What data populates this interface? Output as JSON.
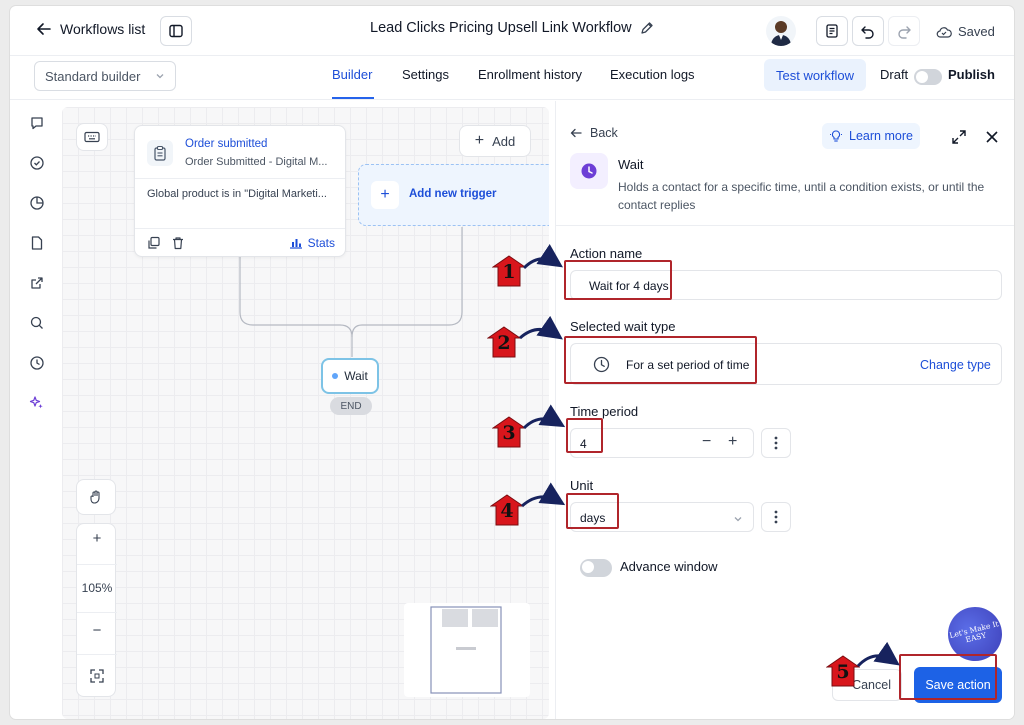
{
  "header": {
    "back_label": "Workflows list",
    "workflow_title": "Lead Clicks Pricing Upsell Link Workflow",
    "saved_label": "Saved"
  },
  "tabs_bar": {
    "builder_select": "Standard builder",
    "tabs": [
      {
        "label": "Builder",
        "active": true
      },
      {
        "label": "Settings",
        "active": false
      },
      {
        "label": "Enrollment history",
        "active": false
      },
      {
        "label": "Execution logs",
        "active": false
      }
    ],
    "test_workflow": "Test workflow",
    "draft_label": "Draft",
    "publish_label": "Publish"
  },
  "canvas": {
    "add_label": "Add",
    "trigger": {
      "title": "Order submitted",
      "subtitle": "Order Submitted - Digital M...",
      "condition": "Global product is in \"Digital Marketi...",
      "stats_label": "Stats"
    },
    "add_new_trigger": "Add new trigger",
    "wait_node_label": "Wait",
    "end_label": "END",
    "zoom_level": "105%",
    "zoom_in": "+",
    "zoom_out": "−"
  },
  "panel": {
    "back_label": "Back",
    "learn_more": "Learn more",
    "action_title": "Wait",
    "action_description": "Holds a contact for a specific time, until a condition exists, or until the contact replies",
    "action_name_label": "Action name",
    "action_name_value": "Wait for 4 days",
    "wait_type_label": "Selected wait type",
    "wait_type_value": "For a set period of time",
    "change_type": "Change type",
    "time_period_label": "Time period",
    "time_period_value": "4",
    "unit_label": "Unit",
    "unit_value": "days",
    "advance_window_label": "Advance window",
    "cancel_label": "Cancel",
    "save_label": "Save action"
  },
  "annotations": {
    "steps": [
      "1",
      "2",
      "3",
      "4",
      "5"
    ],
    "callout_color": "#b0252b",
    "badge_color": "#d8161c",
    "arrow_color": "#17235e"
  },
  "brand": {
    "text": "Let's Make It EASY"
  },
  "colors": {
    "accent": "#1d4ed8",
    "primary_button": "#1d62e6",
    "wait_icon": "#6d3fd6"
  },
  "icons": {
    "back": "arrow-left-icon",
    "sidebar": "sidebar-panel-icon",
    "edit": "pencil-icon",
    "report": "document-report-icon",
    "undo": "undo-icon",
    "redo": "redo-icon",
    "saved": "cloud-check-icon",
    "keyboard": "keyboard-icon",
    "clipboard": "clipboard-icon",
    "copy": "copy-icon",
    "trash": "trash-icon",
    "stats": "bar-chart-icon",
    "clock": "clock-icon",
    "lightbulb": "lightbulb-icon",
    "expand": "expand-icon",
    "close": "close-icon",
    "hand": "hand-icon",
    "fit": "fit-screen-icon"
  }
}
